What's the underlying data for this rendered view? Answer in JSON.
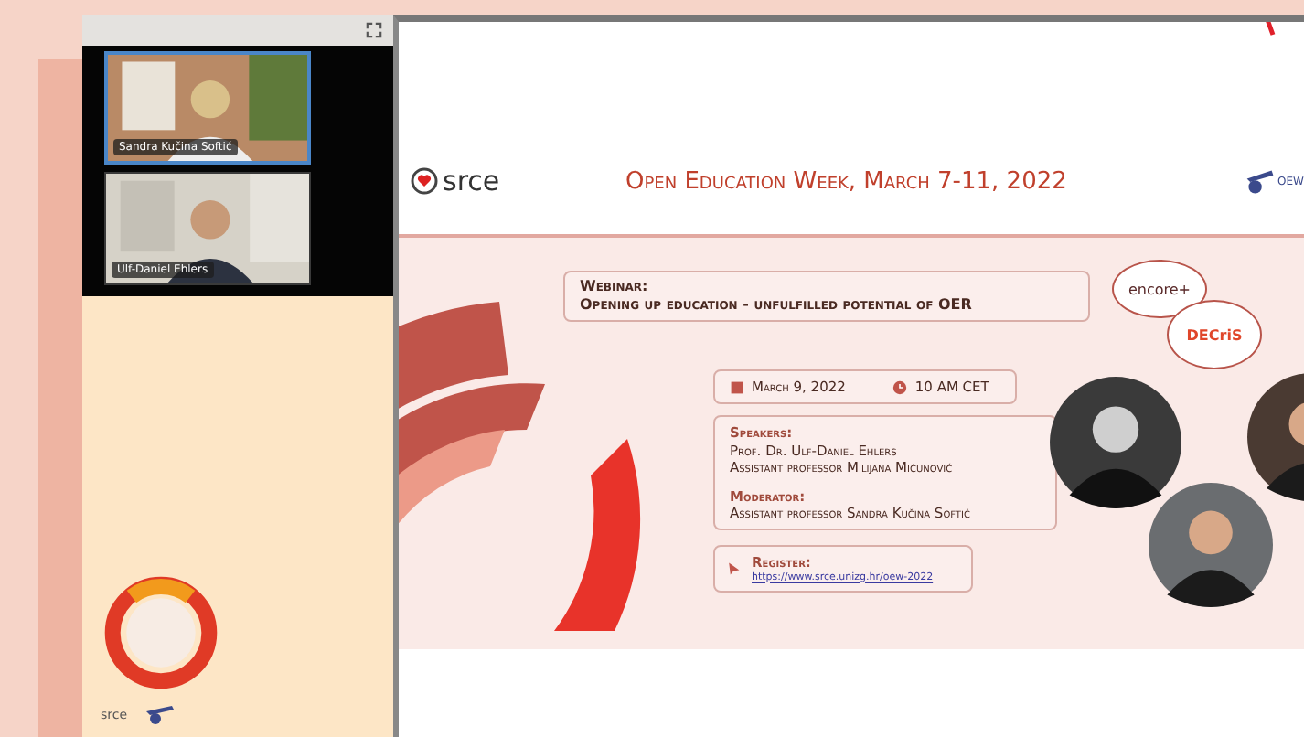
{
  "meeting": {
    "participants": [
      {
        "name": "Sandra Kučina Softić",
        "active": true
      },
      {
        "name": "Ulf-Daniel Ehlers",
        "active": false
      }
    ],
    "footer_brand": "srce"
  },
  "slide": {
    "header": {
      "brand": "srce",
      "title": "Open Education Week, March 7-11, 2022",
      "badge": "OEW"
    },
    "webinar": {
      "label": "Webinar:",
      "title": "Opening up education - unfulfilled potential of OER"
    },
    "partners": [
      "encore+",
      "DECriS"
    ],
    "date": "March 9, 2022",
    "time": "10 AM CET",
    "speakers": {
      "label": "Speakers:",
      "names": [
        "Prof. Dr. Ulf-Daniel Ehlers",
        "Assistant professor Milijana Mićunović"
      ]
    },
    "moderator": {
      "label": "Moderator:",
      "name": "Assistant professor Sandra Kučina Softić"
    },
    "register": {
      "label": "Register:",
      "url": "https://www.srce.unizg.hr/oew-2022"
    }
  }
}
